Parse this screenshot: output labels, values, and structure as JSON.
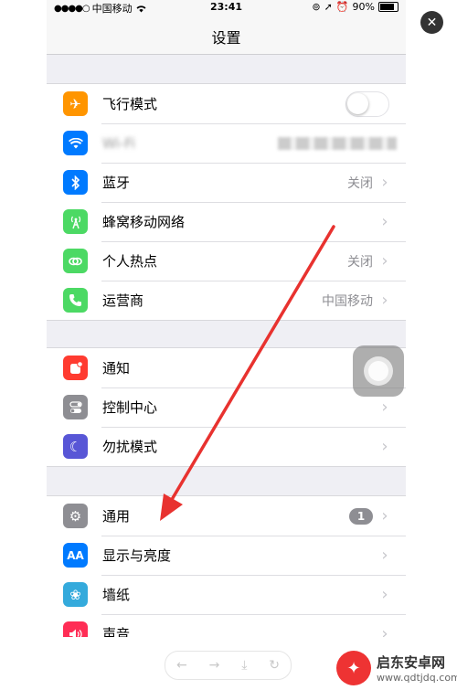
{
  "status": {
    "carrier": "中国移动",
    "time": "23:41",
    "battery": "90%"
  },
  "nav": {
    "title": "设置"
  },
  "groups": [
    {
      "rows": [
        {
          "label": "飞行模式",
          "icon": "airplane-icon",
          "color": "#ff9500",
          "control": "toggle",
          "toggle_on": false
        },
        {
          "label": "Wi-Fi",
          "icon": "wifi-icon",
          "color": "#007aff",
          "value": "",
          "blurred": true
        },
        {
          "label": "蓝牙",
          "icon": "bluetooth-icon",
          "color": "#007aff",
          "value": "关闭"
        },
        {
          "label": "蜂窝移动网络",
          "icon": "cellular-icon",
          "color": "#4cd964",
          "value": ""
        },
        {
          "label": "个人热点",
          "icon": "hotspot-icon",
          "color": "#4cd964",
          "value": "关闭"
        },
        {
          "label": "运营商",
          "icon": "phone-icon",
          "color": "#4cd964",
          "value": "中国移动"
        }
      ]
    },
    {
      "rows": [
        {
          "label": "通知",
          "icon": "notification-icon",
          "color": "#ff3b30",
          "value": ""
        },
        {
          "label": "控制中心",
          "icon": "control-center-icon",
          "color": "#8e8e93",
          "value": ""
        },
        {
          "label": "勿扰模式",
          "icon": "moon-icon",
          "color": "#5856d6",
          "value": ""
        }
      ]
    },
    {
      "rows": [
        {
          "label": "通用",
          "icon": "gear-icon",
          "color": "#8e8e93",
          "badge": "1"
        },
        {
          "label": "显示与亮度",
          "icon": "display-icon",
          "color": "#007aff",
          "value": ""
        },
        {
          "label": "墙纸",
          "icon": "wallpaper-icon",
          "color": "#34aadc",
          "value": ""
        },
        {
          "label": "声音",
          "icon": "sound-icon",
          "color": "#ff2d55",
          "value": ""
        }
      ]
    }
  ],
  "watermark": {
    "name": "启东安卓网",
    "url": "www.qdtjdq.com"
  },
  "colors": {
    "arrow": "#e8322f"
  }
}
